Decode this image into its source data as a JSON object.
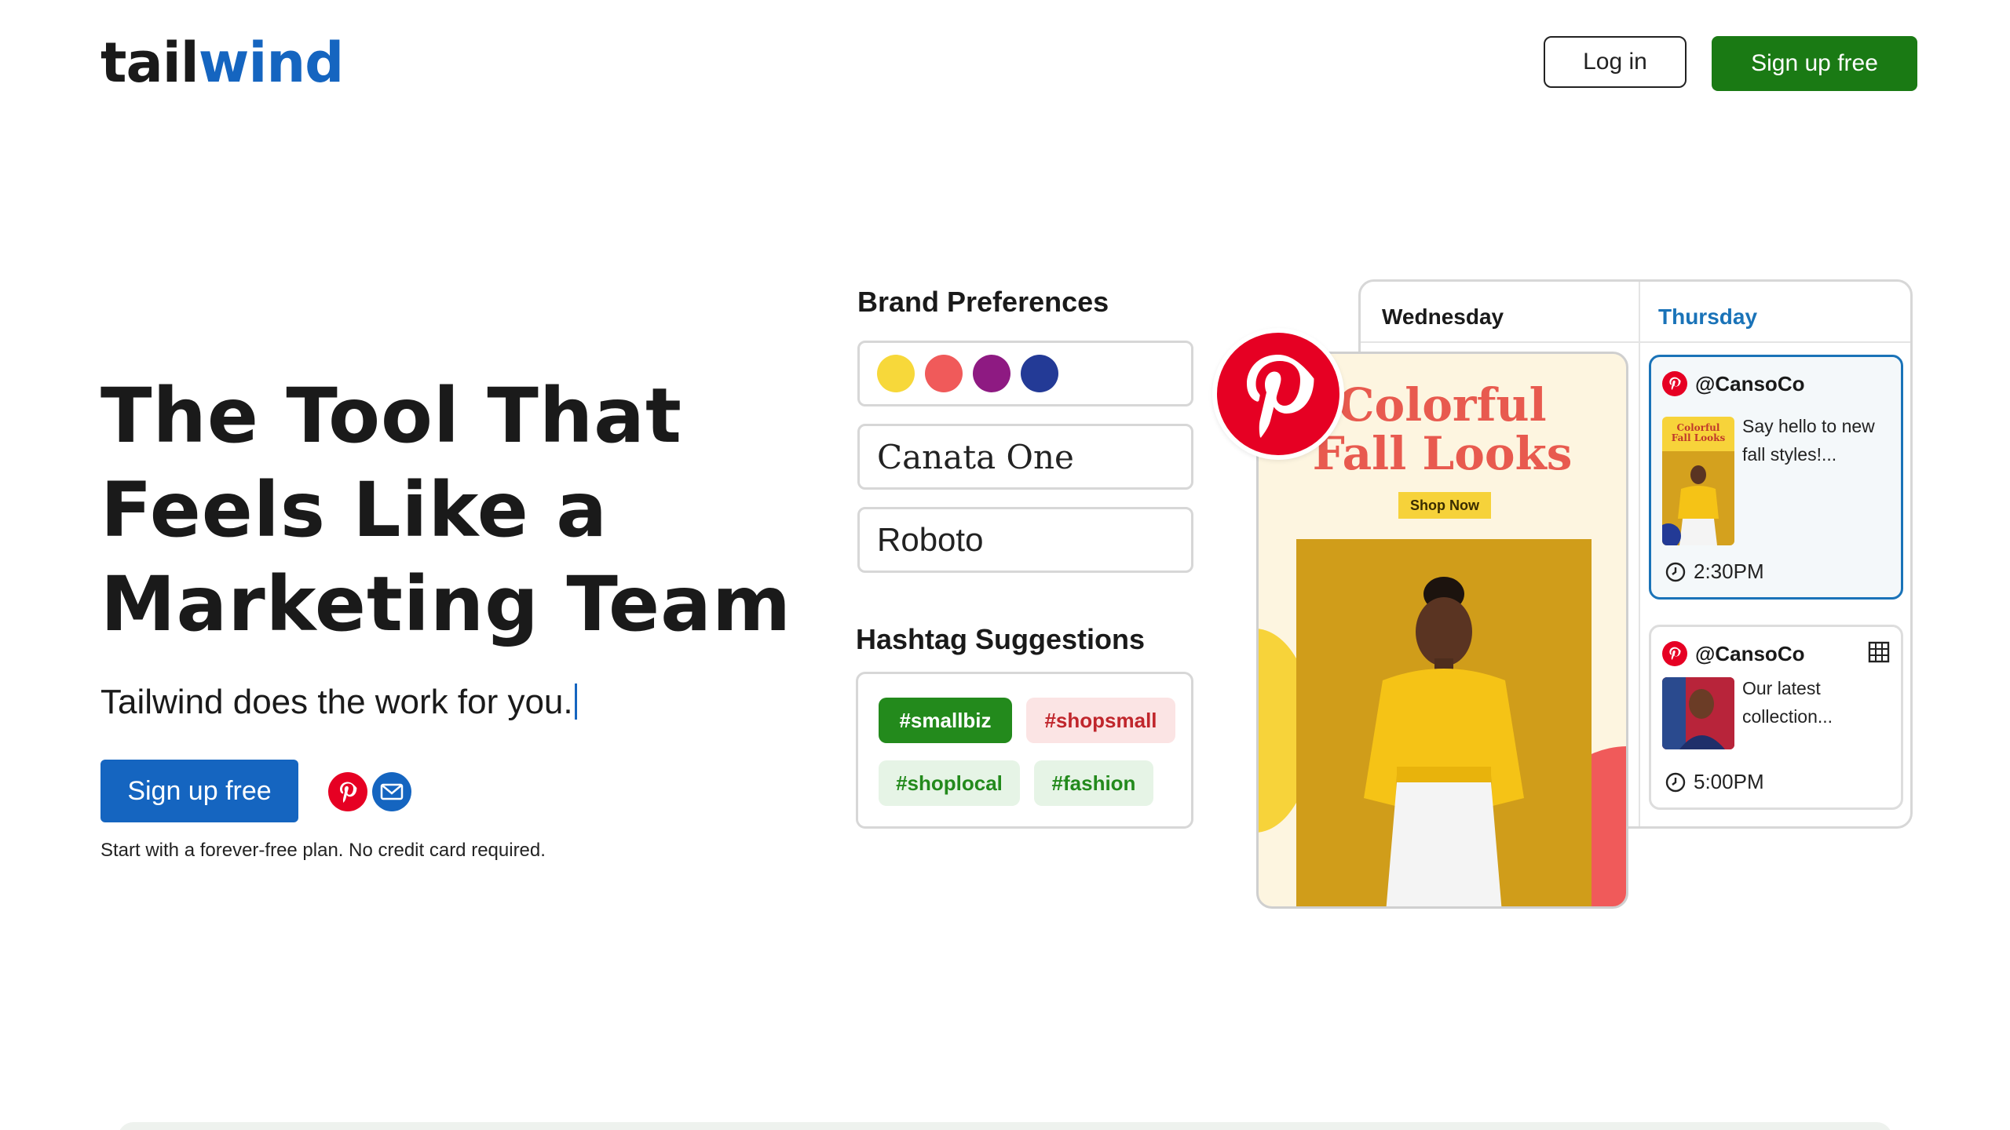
{
  "header": {
    "logo_part1": "tail",
    "logo_part2": "wind",
    "login_label": "Log in",
    "signup_label": "Sign up free"
  },
  "hero": {
    "title_line1": "The Tool That",
    "title_line2": "Feels Like a",
    "title_line3": "Marketing Team",
    "subtitle": "Tailwind does the work for you.",
    "cta_label": "Sign up free",
    "note": "Start with a forever-free plan. No credit card required."
  },
  "brand_preferences": {
    "title": "Brand Preferences",
    "colors": [
      "#f7d83a",
      "#f05a5a",
      "#8e1a82",
      "#233a96"
    ],
    "font_primary": "Canata One",
    "font_secondary": "Roboto"
  },
  "hashtags": {
    "title": "Hashtag Suggestions",
    "tags": [
      "#smallbiz",
      "#shopsmall",
      "#shoplocal",
      "#fashion"
    ]
  },
  "calendar": {
    "day1": "Wednesday",
    "day2": "Thursday",
    "pin": {
      "title_line1": "Colorful",
      "title_line2": "Fall Looks",
      "shop_label": "Shop Now"
    },
    "posts": [
      {
        "handle": "@CansoCo",
        "text": "Say hello to new fall styles!...",
        "time": "2:30PM",
        "thumb_text": "Colorful Fall Looks"
      },
      {
        "handle": "@CansoCo",
        "text": "Our latest collection...",
        "time": "5:00PM"
      }
    ]
  },
  "colors": {
    "brand_blue": "#1565c0",
    "signup_green": "#1a7a14",
    "pinterest_red": "#e60023",
    "thursday_blue": "#1a73b8"
  },
  "icons": [
    "pinterest-icon",
    "mail-icon",
    "clock-icon",
    "grid-icon"
  ]
}
